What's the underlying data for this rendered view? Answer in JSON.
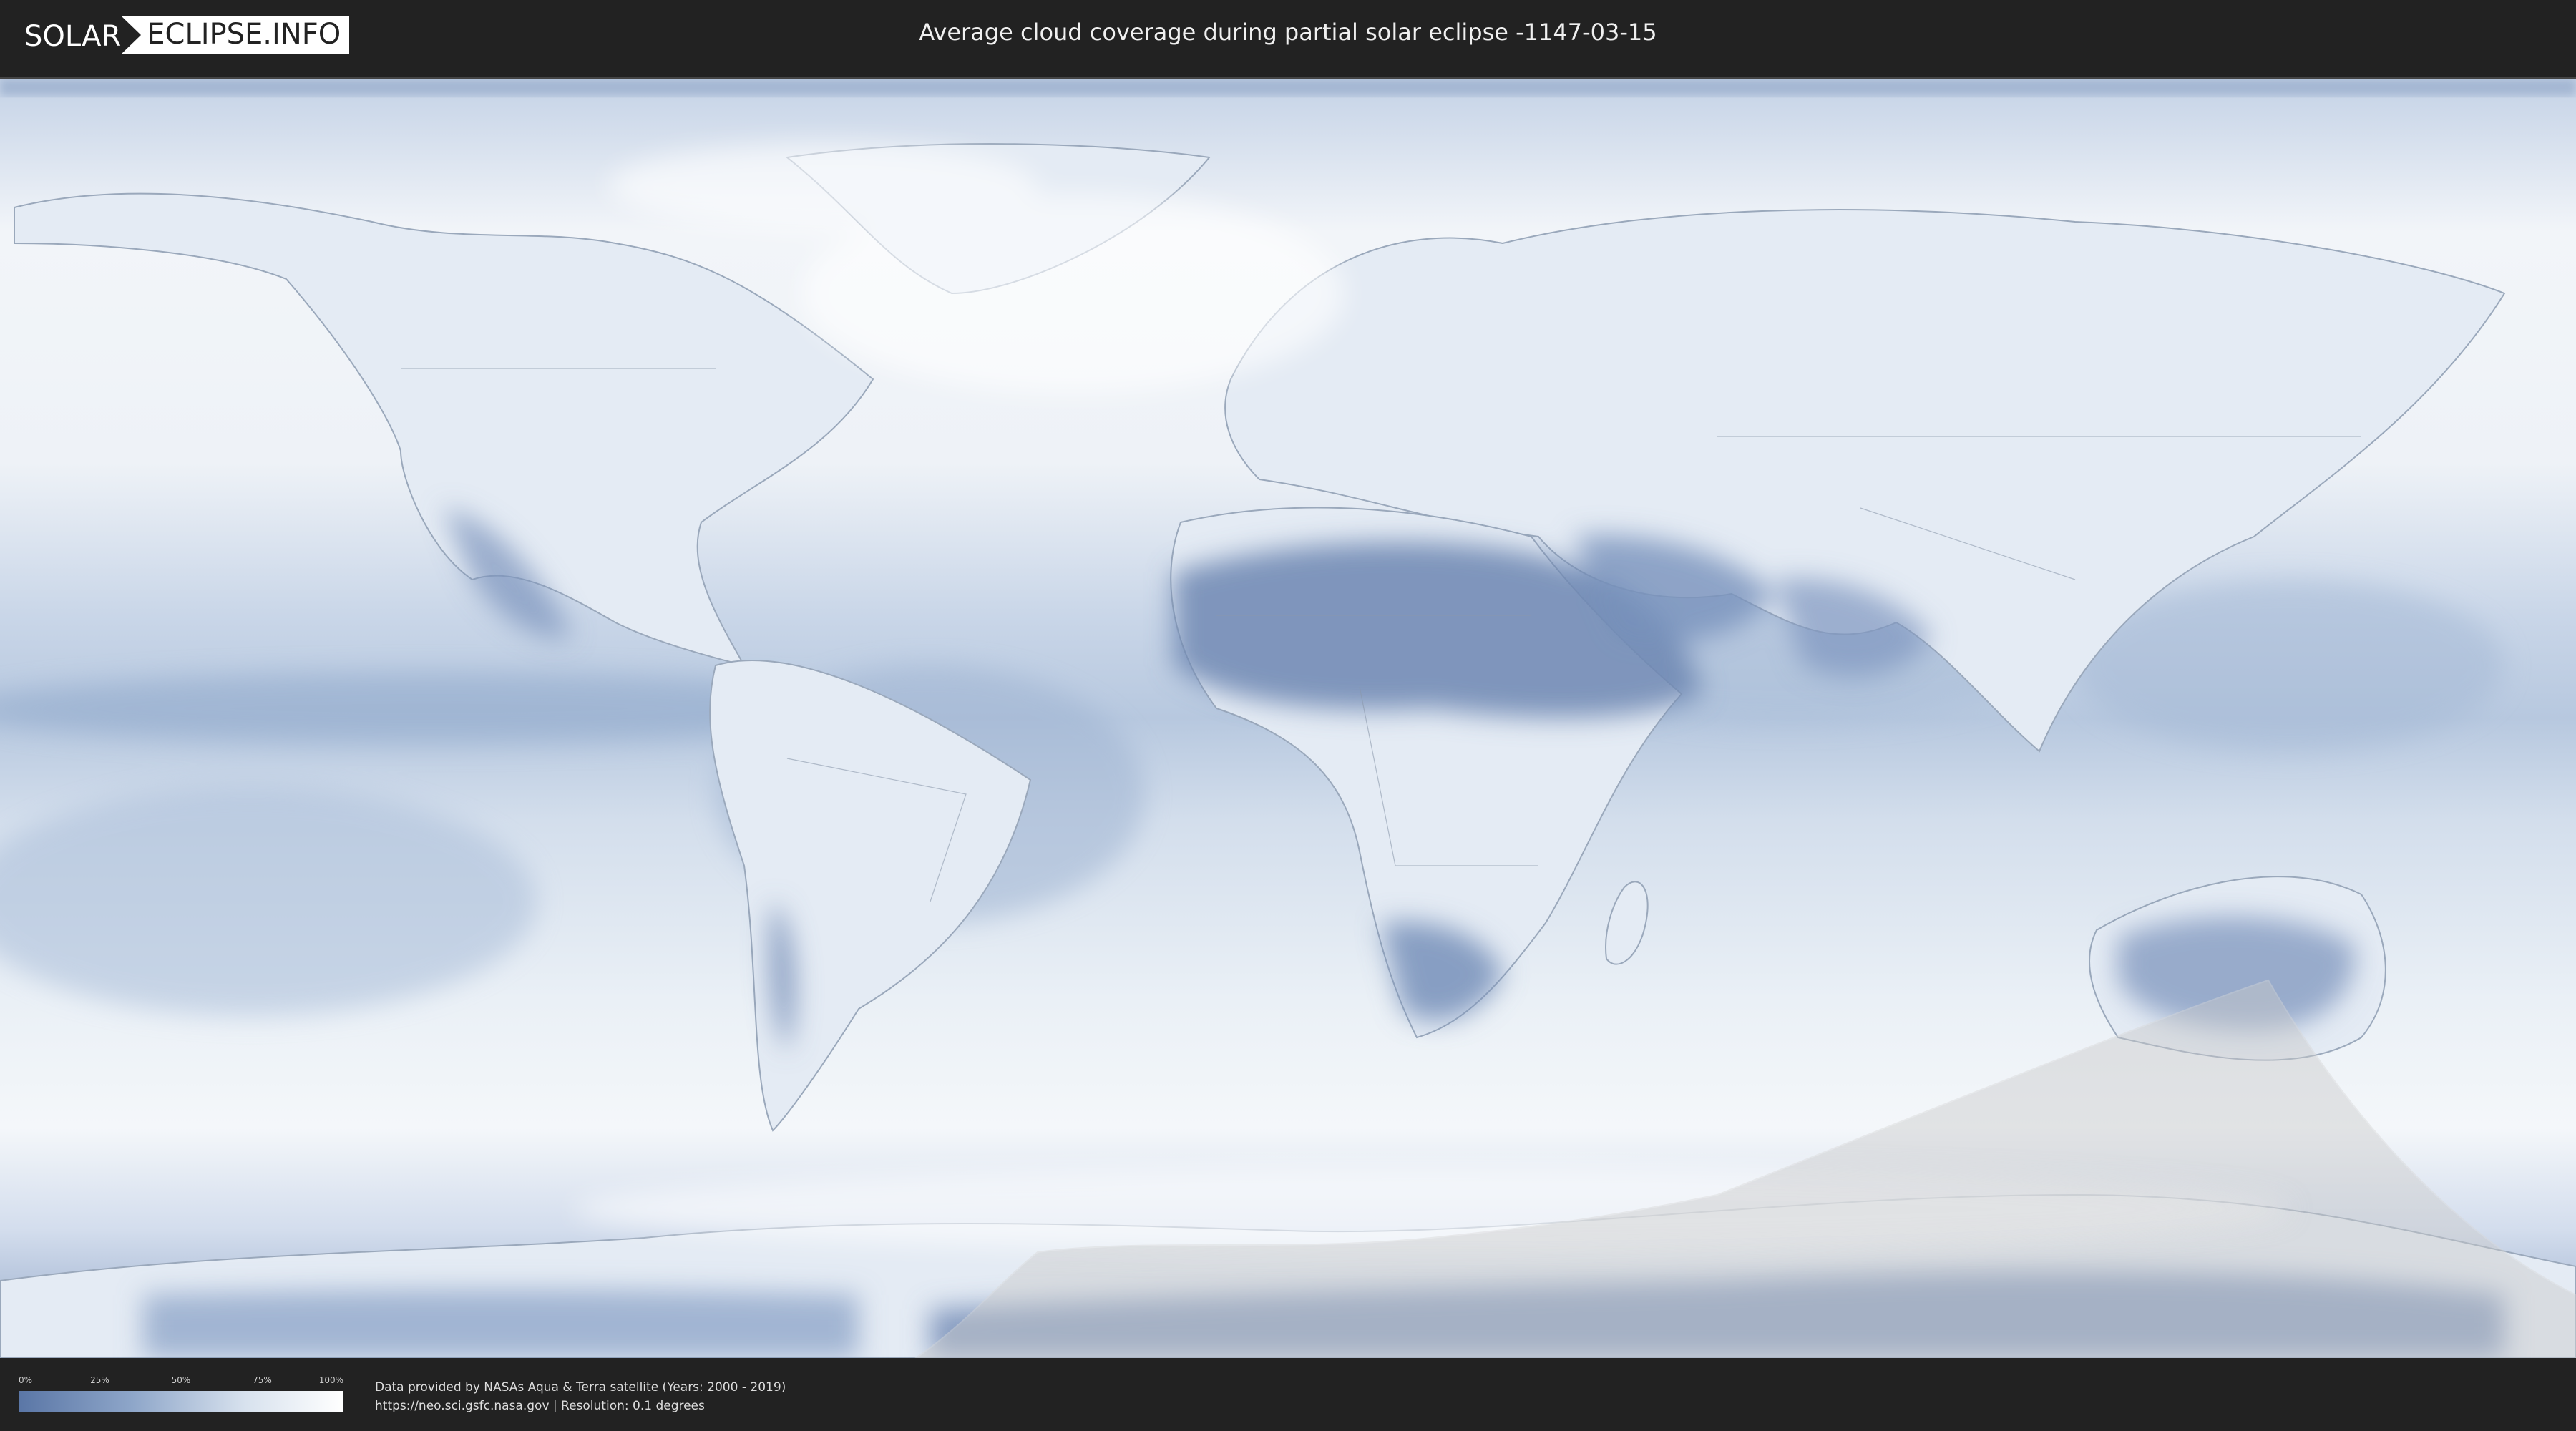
{
  "header": {
    "logo_left": "SOLAR",
    "logo_right": "ECLIPSE.INFO",
    "title": "Average cloud coverage during partial solar eclipse -1147-03-15"
  },
  "legend": {
    "ticks": [
      "0%",
      "25%",
      "50%",
      "75%",
      "100%"
    ],
    "colors": {
      "low": "#5a76a6",
      "mid": "#8ea6c9",
      "high": "#ffffff"
    }
  },
  "credits": {
    "line1": "Data provided by NASAs Aqua & Terra satellite (Years: 2000 - 2019)",
    "line2": "https://neo.sci.gsfc.nasa.gov | Resolution: 0.1 degrees"
  },
  "colors": {
    "background": "#222222",
    "ocean_clouds": "#dfe6f0",
    "clear_sky": "#6c86b2",
    "eclipse_shadow": "#c9c9c9"
  }
}
